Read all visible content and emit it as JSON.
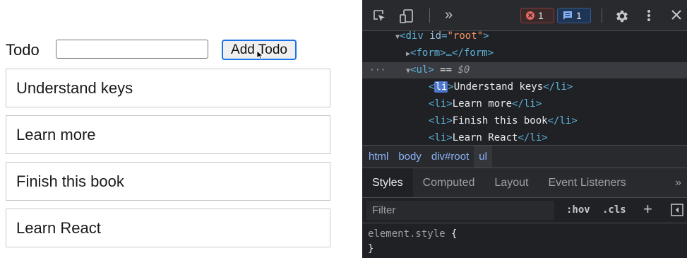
{
  "app": {
    "todo_label": "Todo",
    "input_value": "",
    "input_placeholder": "",
    "add_button_label": "Add Todo",
    "items": [
      {
        "text": "Understand keys"
      },
      {
        "text": "Learn more"
      },
      {
        "text": "Finish this book"
      },
      {
        "text": "Learn React"
      }
    ]
  },
  "devtools": {
    "toolbar": {
      "more_tabs": "»",
      "error_count": "1",
      "message_count": "1",
      "icons": [
        "inspect-icon",
        "device-toggle-icon",
        "gear-icon",
        "kebab-icon",
        "close-icon"
      ]
    },
    "elements": {
      "root_open": "<div id=\"root\">",
      "root_tag": "div",
      "root_attr_name": "id",
      "root_attr_value": "\"root\"",
      "form_line": "<form>…</form>",
      "ul_line": "<ul>",
      "ul_suffix": " == ",
      "dollar0": "$0",
      "ellipsis": "···",
      "li_items": [
        "Understand keys",
        "Learn more",
        "Finish this book",
        "Learn React"
      ]
    },
    "breadcrumbs": [
      "html",
      "body",
      "div#root",
      "ul"
    ],
    "tabs": [
      "Styles",
      "Computed",
      "Layout",
      "Event Listeners"
    ],
    "tabs_more": "»",
    "filter_placeholder": "Filter",
    "hov_label": ":hov",
    "cls_label": ".cls",
    "plus_label": "+",
    "styles": {
      "selector": "element.style",
      "open_brace": "{",
      "close_brace": "}"
    },
    "colors": {
      "background": "#202124",
      "tag": "#5db0d7",
      "attr_value": "#f29766",
      "selection": "#4d78cc",
      "accent_blue": "#1a73e8"
    }
  }
}
